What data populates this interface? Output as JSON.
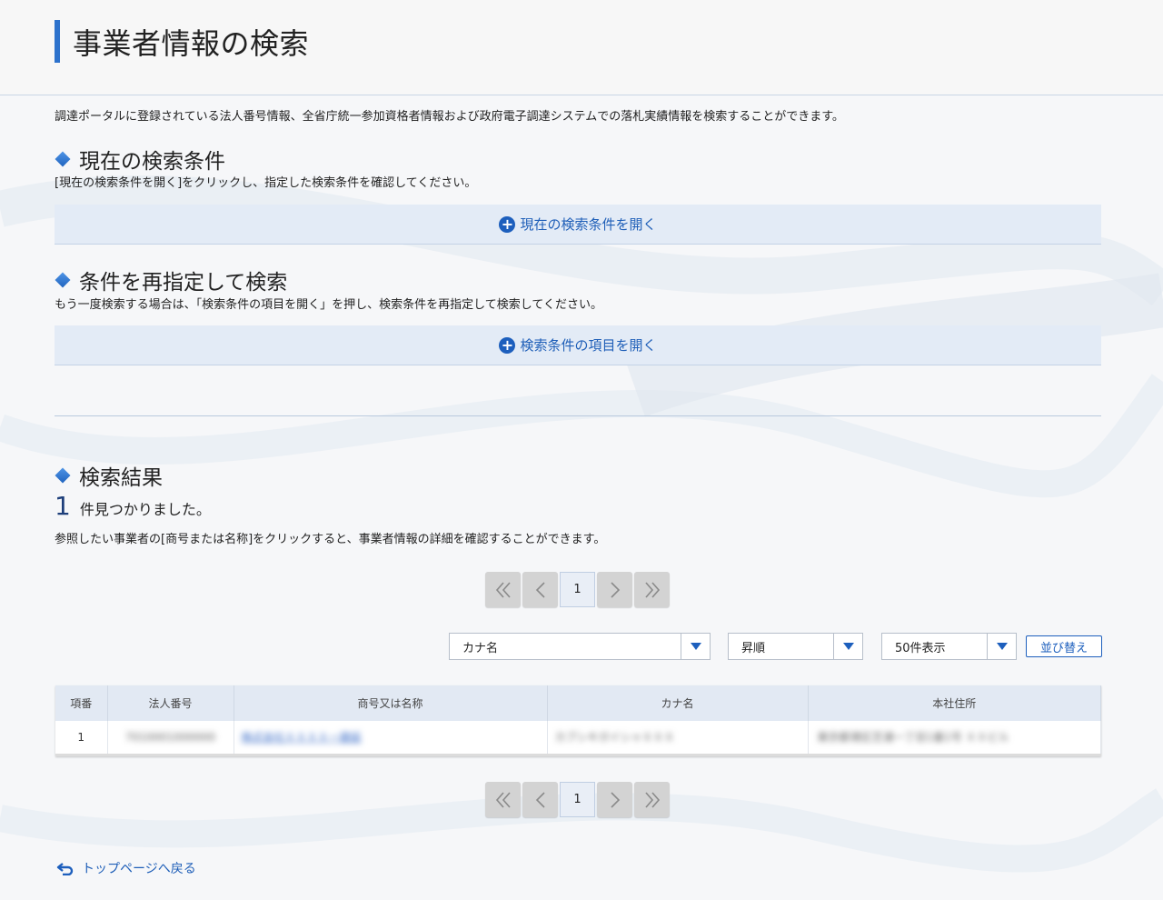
{
  "page": {
    "title": "事業者情報の検索",
    "intro": "調達ポータルに登録されている法人番号情報、全省庁統一参加資格者情報および政府電子調達システムでの落札実績情報を検索することができます。"
  },
  "current_conditions": {
    "heading": "現在の検索条件",
    "description": "[現在の検索条件を開く]をクリックし、指定した検索条件を確認してください。",
    "toggle_label": "現在の検索条件を開く"
  },
  "respecify": {
    "heading": "条件を再指定して検索",
    "description": "もう一度検索する場合は、「検索条件の項目を開く」を押し、検索条件を再指定して検索してください。",
    "toggle_label": "検索条件の項目を開く"
  },
  "results": {
    "heading": "検索結果",
    "count": "1",
    "count_suffix": "件見つかりました。",
    "description": "参照したい事業者の[商号または名称]をクリックすると、事業者情報の詳細を確認することができます。",
    "pager": {
      "current_page": "1"
    },
    "sort": {
      "field": "カナ名",
      "order": "昇順",
      "per_page": "50件表示",
      "button_label": "並び替え"
    },
    "table": {
      "headers": [
        "項番",
        "法人番号",
        "商号又は名称",
        "カナ名",
        "本社住所"
      ],
      "rows": [
        [
          "1",
          "7010001000000",
          "株式会社ＸＸＸＸ一建設",
          "カブシキガイシャＸＸＸ",
          "東京都港区芝浦一丁目1番1号 ＸＸビル"
        ]
      ]
    }
  },
  "footer": {
    "back_link": "トップページへ戻る"
  },
  "colors": {
    "accent": "#2d72cc",
    "link": "#1f5fb8",
    "toggle_bg": "#e3ebf6",
    "table_header_bg": "#e2e9f3"
  }
}
